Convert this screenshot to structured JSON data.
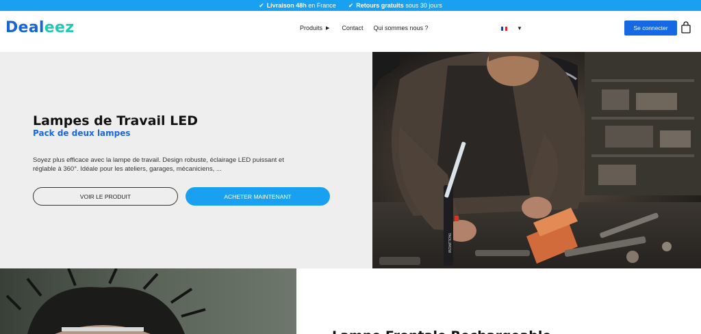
{
  "topbar": {
    "items": [
      {
        "bold": "Livraison 48h",
        "rest": " en France"
      },
      {
        "bold": "Retours gratuits",
        "rest": " sous 30 jours"
      }
    ]
  },
  "header": {
    "logo_part1": "Deal",
    "logo_part2": "eez",
    "nav": {
      "products": "Produits",
      "contact": "Contact",
      "about": "Qui sommes nous ?"
    },
    "login_label": "Se connecter"
  },
  "hero": {
    "title": "Lampes de Travail LED",
    "subtitle": "Pack de deux lampes",
    "description": "Soyez plus efficace avec la lampe de travail. Design robuste, éclairage LED puissant et réglable à 360°. Idéale pour les ateliers, garages, mécaniciens, ...",
    "view_product_label": "VOIR LE PRODUIT",
    "buy_now_label": "ACHETER MAINTENANT",
    "lamp_brand": "TAOLUMOW"
  },
  "section2": {
    "title": "Lampe Frontale Rechargeable"
  },
  "colors": {
    "topbar": "#1aa0f0",
    "brand_blue": "#1668e3",
    "brand_teal": "#1fc9b7",
    "hero_bg": "#eeeeee"
  },
  "icons": {
    "check": "check-icon",
    "products_arrow": "triangle-right-icon",
    "flag": "french-flag-icon",
    "lang_caret": "chevron-down-icon",
    "cart": "shopping-bag-icon"
  }
}
